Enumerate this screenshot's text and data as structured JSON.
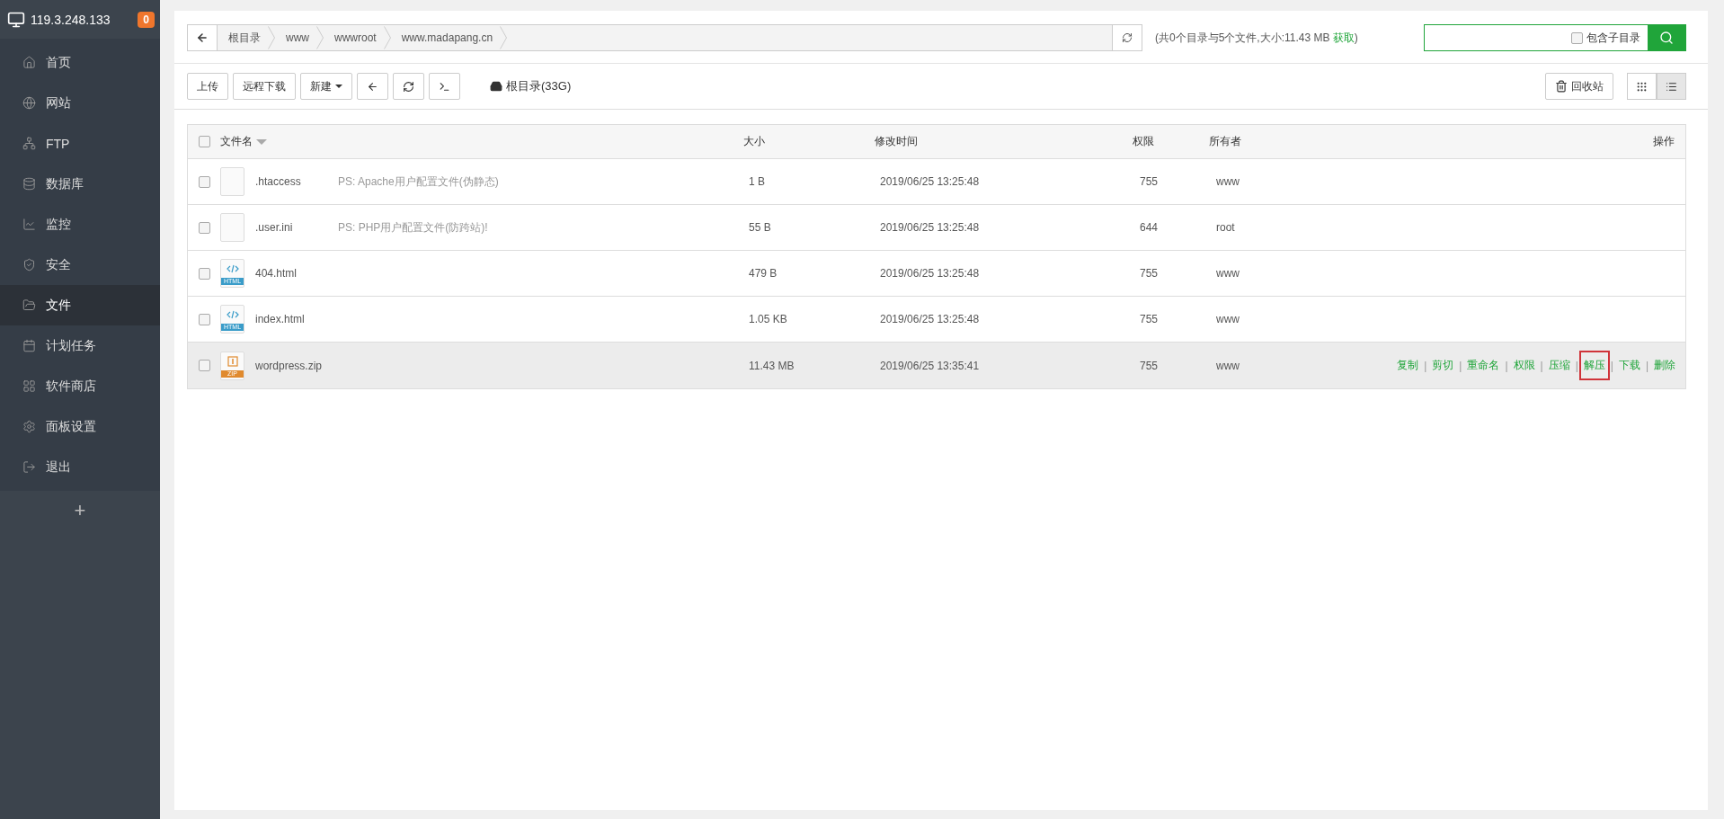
{
  "server": {
    "address": "119.3.248.133",
    "badge": "0"
  },
  "nav": [
    {
      "label": "首页",
      "selected": false
    },
    {
      "label": "网站",
      "selected": false
    },
    {
      "label": "FTP",
      "selected": false
    },
    {
      "label": "数据库",
      "selected": false
    },
    {
      "label": "监控",
      "selected": false
    },
    {
      "label": "安全",
      "selected": false
    },
    {
      "label": "文件",
      "selected": true
    },
    {
      "label": "计划任务",
      "selected": false
    },
    {
      "label": "软件商店",
      "selected": false
    },
    {
      "label": "面板设置",
      "selected": false
    },
    {
      "label": "退出",
      "selected": false
    }
  ],
  "add_label": "+",
  "breadcrumb": {
    "segments": [
      "根目录",
      "www",
      "wwwroot",
      "www.madapang.cn"
    ]
  },
  "summary": {
    "text": "(共0个目录与5个文件,大小:11.43 MB",
    "link": "获取",
    "close": ")"
  },
  "search": {
    "include_label": "包含子目录",
    "include_checked": false
  },
  "toolbar": {
    "buttons": [
      {
        "kind": "text",
        "label": "上传"
      },
      {
        "kind": "text",
        "label": "远程下载"
      },
      {
        "kind": "dropdown",
        "label": "新建"
      },
      {
        "kind": "back"
      },
      {
        "kind": "refresh"
      },
      {
        "kind": "terminal"
      }
    ],
    "disk": "根目录(33G)",
    "recycle": "回收站",
    "views": [
      {
        "kind": "grid",
        "selected": false
      },
      {
        "kind": "list",
        "selected": true
      }
    ]
  },
  "table": {
    "all_checked": false,
    "columns": [
      "文件名",
      "大小",
      "修改时间",
      "权限",
      "所有者",
      "操作"
    ],
    "separator": "|",
    "rows": [
      {
        "name": ".htaccess",
        "kind": "blank",
        "note": "PS: Apache用户配置文件(伪静态)",
        "size": "1 B",
        "modified": "2019/06/25 13:25:48",
        "permission": "755",
        "owner": "www",
        "checked": false,
        "highlighted": false
      },
      {
        "name": ".user.ini",
        "kind": "blank",
        "note": "PS: PHP用户配置文件(防跨站)!",
        "size": "55 B",
        "modified": "2019/06/25 13:25:48",
        "permission": "644",
        "owner": "root",
        "checked": false,
        "highlighted": false
      },
      {
        "name": "404.html",
        "kind": "html",
        "icon_label": "HTML",
        "size": "479 B",
        "modified": "2019/06/25 13:25:48",
        "permission": "755",
        "owner": "www",
        "checked": false,
        "highlighted": false
      },
      {
        "name": "index.html",
        "kind": "html",
        "icon_label": "HTML",
        "size": "1.05 KB",
        "modified": "2019/06/25 13:25:48",
        "permission": "755",
        "owner": "www",
        "checked": false,
        "highlighted": false
      },
      {
        "name": "wordpress.zip",
        "kind": "zip",
        "icon_label": "ZIP",
        "size": "11.43 MB",
        "modified": "2019/06/25 13:35:41",
        "permission": "755",
        "owner": "www",
        "checked": false,
        "highlighted": true,
        "actions": [
          {
            "label": "复制",
            "marked": false
          },
          {
            "label": "剪切",
            "marked": false
          },
          {
            "label": "重命名",
            "marked": false
          },
          {
            "label": "权限",
            "marked": false
          },
          {
            "label": "压缩",
            "marked": false
          },
          {
            "label": "解压",
            "marked": true
          },
          {
            "label": "下载",
            "marked": false
          },
          {
            "label": "删除",
            "marked": false
          }
        ]
      }
    ]
  }
}
